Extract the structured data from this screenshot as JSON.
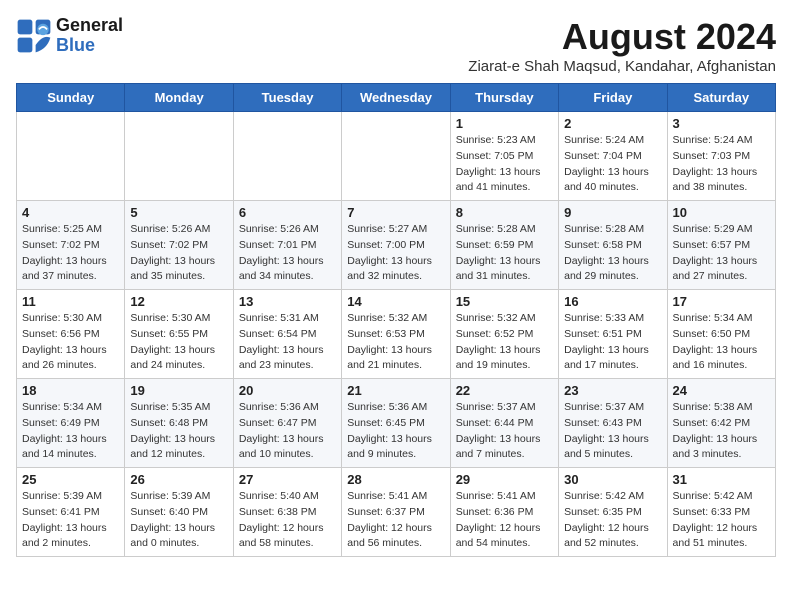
{
  "logo": {
    "line1": "General",
    "line2": "Blue"
  },
  "title": "August 2024",
  "location": "Ziarat-e Shah Maqsud, Kandahar, Afghanistan",
  "weekdays": [
    "Sunday",
    "Monday",
    "Tuesday",
    "Wednesday",
    "Thursday",
    "Friday",
    "Saturday"
  ],
  "weeks": [
    [
      {
        "day": "",
        "info": ""
      },
      {
        "day": "",
        "info": ""
      },
      {
        "day": "",
        "info": ""
      },
      {
        "day": "",
        "info": ""
      },
      {
        "day": "1",
        "info": "Sunrise: 5:23 AM\nSunset: 7:05 PM\nDaylight: 13 hours\nand 41 minutes."
      },
      {
        "day": "2",
        "info": "Sunrise: 5:24 AM\nSunset: 7:04 PM\nDaylight: 13 hours\nand 40 minutes."
      },
      {
        "day": "3",
        "info": "Sunrise: 5:24 AM\nSunset: 7:03 PM\nDaylight: 13 hours\nand 38 minutes."
      }
    ],
    [
      {
        "day": "4",
        "info": "Sunrise: 5:25 AM\nSunset: 7:02 PM\nDaylight: 13 hours\nand 37 minutes."
      },
      {
        "day": "5",
        "info": "Sunrise: 5:26 AM\nSunset: 7:02 PM\nDaylight: 13 hours\nand 35 minutes."
      },
      {
        "day": "6",
        "info": "Sunrise: 5:26 AM\nSunset: 7:01 PM\nDaylight: 13 hours\nand 34 minutes."
      },
      {
        "day": "7",
        "info": "Sunrise: 5:27 AM\nSunset: 7:00 PM\nDaylight: 13 hours\nand 32 minutes."
      },
      {
        "day": "8",
        "info": "Sunrise: 5:28 AM\nSunset: 6:59 PM\nDaylight: 13 hours\nand 31 minutes."
      },
      {
        "day": "9",
        "info": "Sunrise: 5:28 AM\nSunset: 6:58 PM\nDaylight: 13 hours\nand 29 minutes."
      },
      {
        "day": "10",
        "info": "Sunrise: 5:29 AM\nSunset: 6:57 PM\nDaylight: 13 hours\nand 27 minutes."
      }
    ],
    [
      {
        "day": "11",
        "info": "Sunrise: 5:30 AM\nSunset: 6:56 PM\nDaylight: 13 hours\nand 26 minutes."
      },
      {
        "day": "12",
        "info": "Sunrise: 5:30 AM\nSunset: 6:55 PM\nDaylight: 13 hours\nand 24 minutes."
      },
      {
        "day": "13",
        "info": "Sunrise: 5:31 AM\nSunset: 6:54 PM\nDaylight: 13 hours\nand 23 minutes."
      },
      {
        "day": "14",
        "info": "Sunrise: 5:32 AM\nSunset: 6:53 PM\nDaylight: 13 hours\nand 21 minutes."
      },
      {
        "day": "15",
        "info": "Sunrise: 5:32 AM\nSunset: 6:52 PM\nDaylight: 13 hours\nand 19 minutes."
      },
      {
        "day": "16",
        "info": "Sunrise: 5:33 AM\nSunset: 6:51 PM\nDaylight: 13 hours\nand 17 minutes."
      },
      {
        "day": "17",
        "info": "Sunrise: 5:34 AM\nSunset: 6:50 PM\nDaylight: 13 hours\nand 16 minutes."
      }
    ],
    [
      {
        "day": "18",
        "info": "Sunrise: 5:34 AM\nSunset: 6:49 PM\nDaylight: 13 hours\nand 14 minutes."
      },
      {
        "day": "19",
        "info": "Sunrise: 5:35 AM\nSunset: 6:48 PM\nDaylight: 13 hours\nand 12 minutes."
      },
      {
        "day": "20",
        "info": "Sunrise: 5:36 AM\nSunset: 6:47 PM\nDaylight: 13 hours\nand 10 minutes."
      },
      {
        "day": "21",
        "info": "Sunrise: 5:36 AM\nSunset: 6:45 PM\nDaylight: 13 hours\nand 9 minutes."
      },
      {
        "day": "22",
        "info": "Sunrise: 5:37 AM\nSunset: 6:44 PM\nDaylight: 13 hours\nand 7 minutes."
      },
      {
        "day": "23",
        "info": "Sunrise: 5:37 AM\nSunset: 6:43 PM\nDaylight: 13 hours\nand 5 minutes."
      },
      {
        "day": "24",
        "info": "Sunrise: 5:38 AM\nSunset: 6:42 PM\nDaylight: 13 hours\nand 3 minutes."
      }
    ],
    [
      {
        "day": "25",
        "info": "Sunrise: 5:39 AM\nSunset: 6:41 PM\nDaylight: 13 hours\nand 2 minutes."
      },
      {
        "day": "26",
        "info": "Sunrise: 5:39 AM\nSunset: 6:40 PM\nDaylight: 13 hours\nand 0 minutes."
      },
      {
        "day": "27",
        "info": "Sunrise: 5:40 AM\nSunset: 6:38 PM\nDaylight: 12 hours\nand 58 minutes."
      },
      {
        "day": "28",
        "info": "Sunrise: 5:41 AM\nSunset: 6:37 PM\nDaylight: 12 hours\nand 56 minutes."
      },
      {
        "day": "29",
        "info": "Sunrise: 5:41 AM\nSunset: 6:36 PM\nDaylight: 12 hours\nand 54 minutes."
      },
      {
        "day": "30",
        "info": "Sunrise: 5:42 AM\nSunset: 6:35 PM\nDaylight: 12 hours\nand 52 minutes."
      },
      {
        "day": "31",
        "info": "Sunrise: 5:42 AM\nSunset: 6:33 PM\nDaylight: 12 hours\nand 51 minutes."
      }
    ]
  ]
}
